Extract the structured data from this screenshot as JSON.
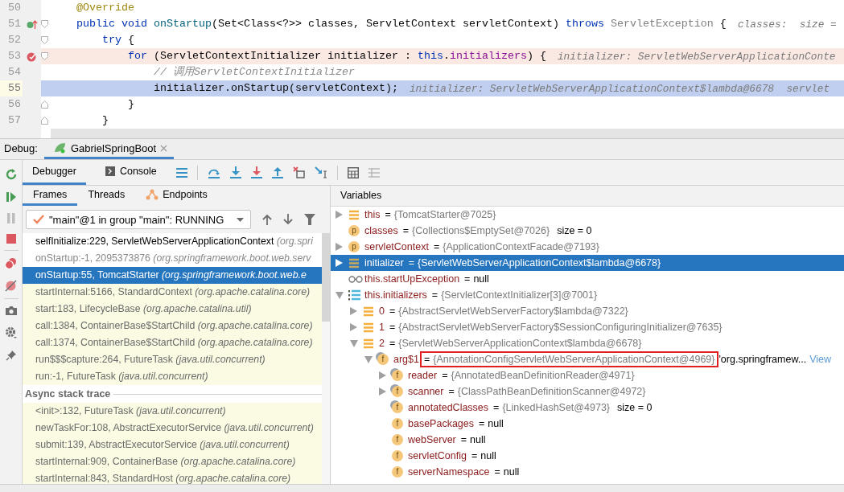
{
  "editor": {
    "lines": [
      {
        "number": "50",
        "kind": "normal",
        "tokens": [
          {
            "t": "@Override",
            "kind": "ann"
          }
        ]
      },
      {
        "number": "51",
        "kind": "override",
        "tokens": [
          {
            "t": "public ",
            "kind": "kw"
          },
          {
            "t": "void ",
            "kind": "kw"
          },
          {
            "t": "onStartup",
            "kind": "fn"
          },
          {
            "t": "(Set<Class<?>> classes, ServletContext servletContext) ",
            "kind": "plain"
          },
          {
            "t": "throws ",
            "kind": "kw"
          },
          {
            "t": "ServletException",
            "kind": "type"
          },
          {
            "t": " {",
            "kind": "plain"
          }
        ],
        "hint": "classes:  size ="
      },
      {
        "number": "52",
        "kind": "normal",
        "tokens": [
          {
            "t": "try",
            "kind": "kw"
          },
          {
            "t": " {",
            "kind": "plain"
          }
        ]
      },
      {
        "number": "53",
        "kind": "breakpoint",
        "tokens": [
          {
            "t": "for",
            "kind": "kw"
          },
          {
            "t": " (ServletContextInitializer initializer : ",
            "kind": "plain"
          },
          {
            "t": "this",
            "kind": "kw"
          },
          {
            "t": ".",
            "kind": "plain"
          },
          {
            "t": "initializers",
            "kind": "field"
          },
          {
            "t": ") {",
            "kind": "plain"
          }
        ],
        "hint": "initializer: ServletWebServerApplicationConte"
      },
      {
        "number": "54",
        "kind": "normal",
        "tokens": [
          {
            "t": "// 调用ServletContextInitializer",
            "kind": "comment"
          }
        ]
      },
      {
        "number": "55",
        "kind": "execution",
        "tokens": [
          {
            "t": "initializer.onStartup(servletContext);",
            "kind": "plain"
          }
        ],
        "hint": "initializer: ServletWebServerApplicationContext$lambda@6678  servlet"
      },
      {
        "number": "56",
        "kind": "normal",
        "tokens": [
          {
            "t": "}",
            "kind": "plain"
          }
        ]
      },
      {
        "number": "57",
        "kind": "normal",
        "tokens": [
          {
            "t": "}",
            "kind": "plain"
          }
        ]
      }
    ]
  },
  "debug_bar": {
    "label": "Debug:",
    "tab": "GabrielSpringBoot"
  },
  "tool_tabs": [
    {
      "label": "Debugger",
      "selected": true
    },
    {
      "label": "Console",
      "selected": false
    }
  ],
  "frames_tabs": [
    {
      "label": "Frames",
      "selected": true
    },
    {
      "label": "Threads",
      "selected": false
    },
    {
      "label": "Endpoints",
      "selected": false
    }
  ],
  "thread_selector": {
    "value": "\"main\"@1 in group \"main\": RUNNING"
  },
  "frames": [
    {
      "text": "selfInitialize:229, ServletWebServerApplicationContext",
      "location": "(org.spri",
      "kind": "app",
      "selected": false
    },
    {
      "text": "onStartup:-1, 2095373876",
      "location": "(org.springframework.boot.web.serv",
      "kind": "hidden",
      "selected": false
    },
    {
      "text": "onStartup:55, TomcatStarter",
      "location": "(org.springframework.boot.web.e",
      "kind": "app",
      "selected": true
    },
    {
      "text": "startInternal:5166, StandardContext",
      "location": "(org.apache.catalina.core)",
      "kind": "library",
      "selected": false
    },
    {
      "text": "start:183, LifecycleBase",
      "location": "(org.apache.catalina.util)",
      "kind": "library",
      "selected": false
    },
    {
      "text": "call:1384, ContainerBase$StartChild",
      "location": "(org.apache.catalina.core)",
      "kind": "library",
      "selected": false
    },
    {
      "text": "call:1374, ContainerBase$StartChild",
      "location": "(org.apache.catalina.core)",
      "kind": "library",
      "selected": false
    },
    {
      "text": "run$$$capture:264, FutureTask",
      "location": "(java.util.concurrent)",
      "kind": "library",
      "selected": false
    },
    {
      "text": "run:-1, FutureTask",
      "location": "(java.util.concurrent)",
      "kind": "library",
      "selected": false
    }
  ],
  "async_header": "Async stack trace",
  "async_frames": [
    {
      "text": "<init>:132, FutureTask",
      "location": "(java.util.concurrent)",
      "kind": "library",
      "selected": false
    },
    {
      "text": "newTaskFor:108, AbstractExecutorService",
      "location": "(java.util.concurrent)",
      "kind": "library",
      "selected": false
    },
    {
      "text": "submit:139, AbstractExecutorService",
      "location": "(java.util.concurrent)",
      "kind": "library",
      "selected": false
    },
    {
      "text": "startInternal:909, ContainerBase",
      "location": "(org.apache.catalina.core)",
      "kind": "library",
      "selected": false
    },
    {
      "text": "startInternal:843, StandardHost",
      "location": "(org.apache.catalina.core)",
      "kind": "library",
      "selected": false
    }
  ],
  "variables_title": "Variables",
  "variables": [
    {
      "name": "this",
      "op": "=",
      "ref": "{TomcatStarter@7025}",
      "kind": "object",
      "expanded": false,
      "selected": false
    },
    {
      "name": "classes",
      "op": "=",
      "ref": "{Collections$EmptySet@7026}",
      "extra": "size = 0",
      "kind": "param",
      "badge": "p",
      "selected": false
    },
    {
      "name": "servletContext",
      "op": "=",
      "ref": "{ApplicationContextFacade@7193}",
      "kind": "param",
      "badge": "p",
      "expanded": false,
      "selected": false
    },
    {
      "name": "initializer",
      "op": "=",
      "ref": "{ServletWebServerApplicationContext$lambda@6678}",
      "kind": "object",
      "expanded": false,
      "selected": true
    },
    {
      "name": "this.startUpException",
      "op": "=",
      "value": "null",
      "kind": "watch",
      "selected": false
    },
    {
      "name": "this.initializers",
      "op": "=",
      "ref": "{ServletContextInitializer[3]@7001}",
      "kind": "array",
      "expanded": true,
      "selected": false,
      "children": [
        {
          "name": "0",
          "op": "=",
          "ref": "{AbstractServletWebServerFactory$lambda@7322}",
          "kind": "object",
          "expanded": false,
          "selected": false
        },
        {
          "name": "1",
          "op": "=",
          "ref": "{AbstractServletWebServerFactory$SessionConfiguringInitializer@7635}",
          "kind": "object",
          "expanded": false,
          "selected": false
        },
        {
          "name": "2",
          "op": "=",
          "ref": "{ServletWebServerApplicationContext$lambda@6678}",
          "kind": "object",
          "expanded": true,
          "selected": false,
          "children": [
            {
              "name": "arg$1",
              "op": "=",
              "ref": "{AnnotationConfigServletWebServerApplicationContext@4969}",
              "kind": "field",
              "badge": "f",
              "final": true,
              "expanded": true,
              "selected": false,
              "boxed": true,
              "extra": "'org.springframew...",
              "link": "View",
              "children": [
                {
                  "name": "reader",
                  "op": "=",
                  "ref": "{AnnotatedBeanDefinitionReader@4971}",
                  "kind": "field",
                  "badge": "f",
                  "final": true,
                  "expanded": false,
                  "selected": false
                },
                {
                  "name": "scanner",
                  "op": "=",
                  "ref": "{ClassPathBeanDefinitionScanner@4972}",
                  "kind": "field",
                  "badge": "f",
                  "final": true,
                  "expanded": false,
                  "selected": false
                },
                {
                  "name": "annotatedClasses",
                  "op": "=",
                  "ref": "{LinkedHashSet@4973}",
                  "extra": "size = 0",
                  "kind": "field",
                  "badge": "f",
                  "final": true,
                  "selected": false
                },
                {
                  "name": "basePackages",
                  "op": "=",
                  "value": "null",
                  "kind": "field",
                  "badge": "f",
                  "selected": false
                },
                {
                  "name": "webServer",
                  "op": "=",
                  "value": "null",
                  "kind": "field",
                  "badge": "f",
                  "selected": false
                },
                {
                  "name": "servletConfig",
                  "op": "=",
                  "value": "null",
                  "kind": "field",
                  "badge": "f",
                  "selected": false
                },
                {
                  "name": "serverNamespace",
                  "op": "=",
                  "value": "null",
                  "kind": "field",
                  "badge": "f",
                  "selected": false
                }
              ]
            }
          ]
        }
      ]
    }
  ]
}
